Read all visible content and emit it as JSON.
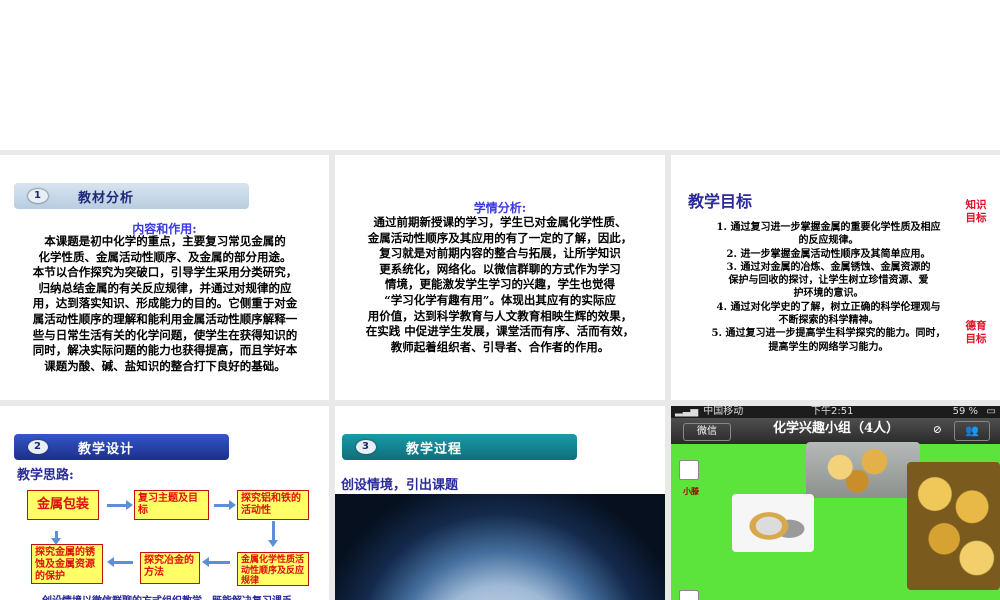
{
  "slide1": {
    "ribbon_num": "1",
    "ribbon_title": "教材分析",
    "subtitle": "内容和作用:",
    "lines": [
      "本课题是初中化学的重点，主要复习常见金属的",
      "化学性质、金属活动性顺序、及金属的部分用途。",
      "本节以合作探究为突破口，引导学生采用分类研究，",
      "归纳总结金属的有关反应规律，并通过对规律的应",
      "用，达到落实知识、形成能力的目的。它侧重于对金",
      "属活动性顺序的理解和能利用金属活动性顺序解释一",
      "些与日常生活有关的化学问题，使学生在获得知识的",
      "同时，解决实际问题的能力也获得提高，而且学好本",
      "课题为酸、碱、盐知识的整合打下良好的基础。"
    ]
  },
  "slide2": {
    "subtitle": "学情分析:",
    "lines": [
      "通过前期新授课的学习，学生已对金属化学性质、",
      "金属活动性顺序及其应用的有了一定的了解，因此，",
      "复习就是对前期内容的整合与拓展，让所学知识",
      "更系统化，网络化。以微信群聊的方式作为学习",
      "情境，更能激发学生学习的兴趣，学生也觉得",
      "“学习化学有趣有用”。体现出其应有的实际应",
      "用价值，达到科学教育与人文教育相映生辉的效果，",
      "在实践 中促进学生发展，课堂活而有序、活而有效，",
      "教师起着组织者、引导者、合作者的作用。"
    ]
  },
  "slide3": {
    "title": "教学目标",
    "label_knowledge": "知识目标",
    "label_moral": "德育目标",
    "goals": [
      "1. 通过复习进一步掌握金属的重要化学性质及相应",
      "的反应规律。",
      "2. 进一步掌握金属活动性顺序及其简单应用。",
      "3. 通过对金属的冶炼、金属锈蚀、金属资源的",
      "保护与回收的探讨，让学生树立珍惜资源、爱",
      "护环境的意识。",
      "4. 通过对化学史的了解，树立正确的科学伦理观与",
      "不断探索的科学精神。",
      "5.  通过复习进一步提高学生科学探究的能力。同时，",
      "提高学生的网络学习能力。"
    ]
  },
  "slide4": {
    "ribbon_num": "2",
    "ribbon_title": "教学设计",
    "think_label": "教学思路:",
    "box_main": "金属包装",
    "box_review": "复习主题及目标",
    "box_explore_al": "探究铝和铁的活动性",
    "box_corrosion": "探究金属的锈蚀及金属资源的保护",
    "box_smelting": "探究冶金的方法",
    "box_properties": "金属化学性质活动性顺序及反应规律",
    "bottom_note": "创设情境以微信群聊的方式组织教学，既能解决复习课乏"
  },
  "slide5": {
    "ribbon_num": "3",
    "ribbon_title": "教学过程",
    "scene_title": "创设情境，引出课题"
  },
  "slide6": {
    "status_carrier": "中国移动",
    "status_time": "下午2:51",
    "status_battery": "59 %",
    "back_label": "微信",
    "chat_title": "化学兴趣小组（4人）",
    "member_name": "小滕",
    "colors": {
      "background": "#5ce33c"
    }
  }
}
